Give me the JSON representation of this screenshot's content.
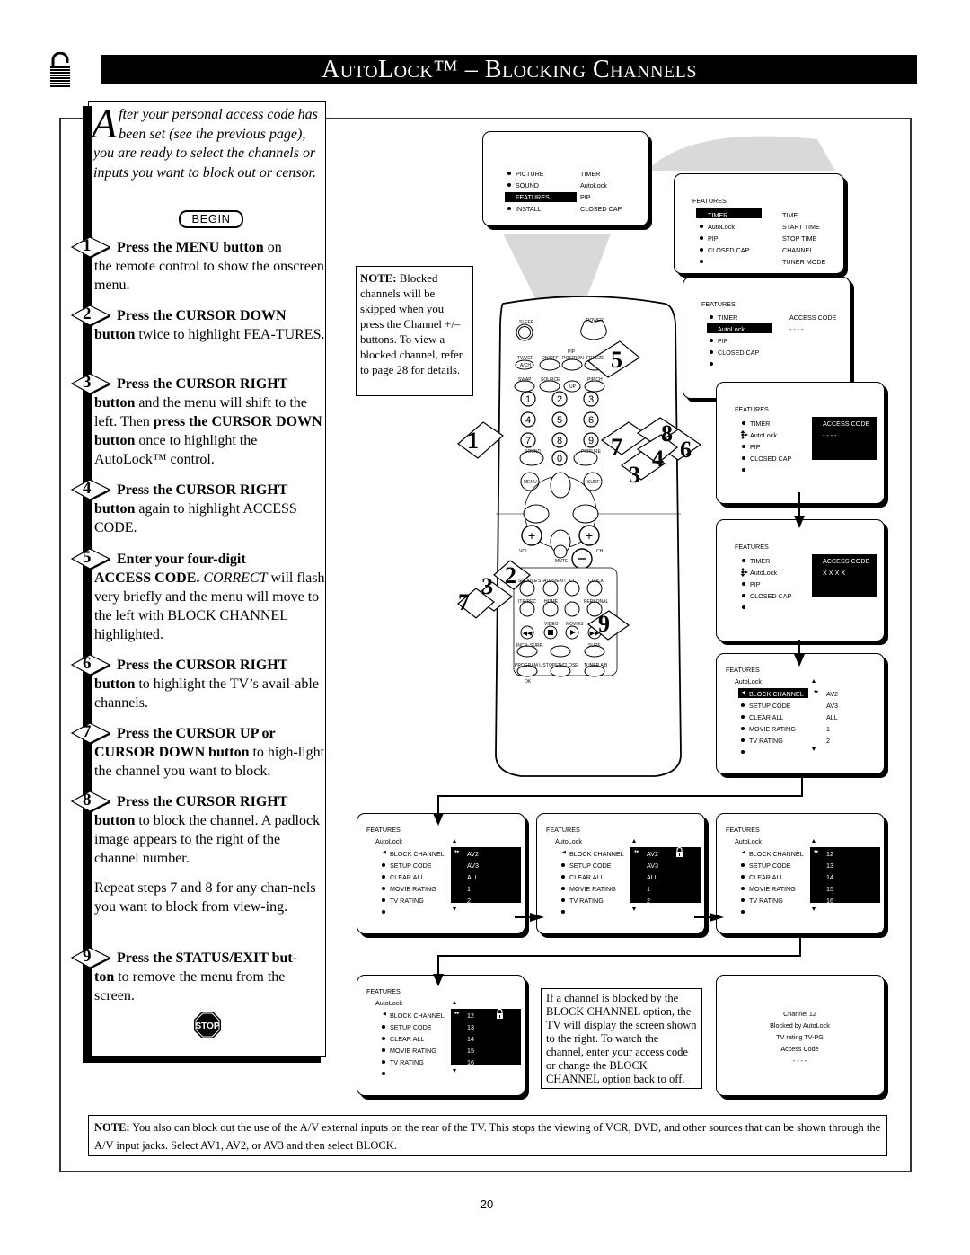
{
  "header": {
    "title": "AutoLock™ – Blocking Channels",
    "icon": "padlock-icon"
  },
  "intro": {
    "dropcap": "A",
    "text": "fter your personal access code has been set (see the previous page), you are ready to select the channels or inputs you want to block out or censor."
  },
  "begin_label": "BEGIN",
  "steps": [
    {
      "num": "1",
      "head": "Press the MENU button",
      "head_tail": " on",
      "body": "the remote control to show the onscreen menu."
    },
    {
      "num": "2",
      "head": "Press the CURSOR DOWN",
      "body_bold": "button",
      "body": " twice to highlight FEA-TURES."
    },
    {
      "num": "3",
      "head": "Press the CURSOR RIGHT",
      "body_bold": "button",
      "body": " and the menu will shift to the left. Then ",
      "body_bold2": "press the CURSOR DOWN button",
      "body2": " once to highlight the AutoLock™ control."
    },
    {
      "num": "4",
      "head": "Press the CURSOR RIGHT",
      "body_bold": "button",
      "body": " again to highlight ACCESS CODE."
    },
    {
      "num": "5",
      "head": "Enter your four-digit",
      "body_bold": "ACCESS CODE.",
      "body_italic": " CORRECT",
      "body": " will flash very briefly and the menu will move to the left with BLOCK CHANNEL highlighted."
    },
    {
      "num": "6",
      "head": "Press the CURSOR RIGHT",
      "body_bold": "button",
      "body": " to highlight the TV’s avail-able channels."
    },
    {
      "num": "7",
      "head": "Press the CURSOR UP or",
      "body_bold": "CURSOR DOWN button",
      "body": " to high-light the channel you want to block."
    },
    {
      "num": "8",
      "head": "Press the CURSOR RIGHT",
      "body_bold": "button",
      "body": " to block the channel.  A padlock image appears to the right of the channel number.",
      "extra": "Repeat steps 7 and 8 for any chan-nels you want to block from view-ing."
    },
    {
      "num": "9",
      "head": "Press the STATUS/EXIT but-",
      "body_bold": "ton",
      "body": " to remove the menu from the screen."
    }
  ],
  "stop_label": "STOP",
  "note_blocked": {
    "label": "NOTE:",
    "text": " Blocked channels will be skipped when you press the Channel +/– buttons.  To view a blocked channel, refer to page 28 for details."
  },
  "screens": {
    "main_menu": {
      "left": [
        "PICTURE",
        "SOUND",
        "FEATURES",
        "INSTALL"
      ],
      "right": [
        "TIMER",
        "AutoLock",
        "PIP",
        "CLOSED CAP"
      ],
      "highlighted": "FEATURES"
    },
    "features_timer": {
      "title": "FEATURES",
      "left": [
        "TIMER",
        "AutoLock",
        "PIP",
        "CLOSED CAP",
        ""
      ],
      "right": [
        "TIME",
        "START TIME",
        "STOP TIME",
        "CHANNEL",
        "TUNER MODE"
      ],
      "highlighted": "TIMER"
    },
    "features_autolock": {
      "title": "FEATURES",
      "left": [
        "TIMER",
        "AutoLock",
        "PIP",
        "CLOSED CAP",
        ""
      ],
      "access_label": "ACCESS CODE",
      "access_value": "- - - -",
      "highlighted": "AutoLock"
    },
    "features_access": {
      "title": "FEATURES",
      "left": [
        "TIMER",
        "AutoLock",
        "PIP",
        "CLOSED CAP",
        ""
      ],
      "access_label": "ACCESS CODE",
      "access_value": "- - - -"
    },
    "features_access_entered": {
      "title": "FEATURES",
      "left": [
        "TIMER",
        "AutoLock",
        "PIP",
        "CLOSED CAP",
        ""
      ],
      "access_label": "ACCESS CODE",
      "access_value": "X X X X"
    },
    "autolock_menu": {
      "title": "FEATURES",
      "subtitle": "AutoLock",
      "left": [
        "BLOCK CHANNEL",
        "SETUP CODE",
        "CLEAR ALL",
        "MOVIE RATING",
        "TV RATING",
        ""
      ],
      "right": [
        "AV2",
        "AV3",
        "ALL",
        "1",
        "2"
      ]
    },
    "autolock_av": {
      "title": "FEATURES",
      "subtitle": "AutoLock",
      "left": [
        "BLOCK CHANNEL",
        "SETUP CODE",
        "CLEAR ALL",
        "MOVIE RATING",
        "TV RATING",
        ""
      ],
      "right": [
        "AV2",
        "AV3",
        "ALL",
        "1",
        "2"
      ]
    },
    "autolock_av_locked": {
      "title": "FEATURES",
      "subtitle": "AutoLock",
      "left": [
        "BLOCK CHANNEL",
        "SETUP CODE",
        "CLEAR ALL",
        "MOVIE RATING",
        "TV RATING",
        ""
      ],
      "right": [
        "AV2",
        "AV3",
        "ALL",
        "1",
        "2"
      ],
      "locked": true
    },
    "autolock_ch": {
      "title": "FEATURES",
      "subtitle": "AutoLock",
      "left": [
        "BLOCK CHANNEL",
        "SETUP CODE",
        "CLEAR ALL",
        "MOVIE RATING",
        "TV RATING",
        ""
      ],
      "right": [
        "12",
        "13",
        "14",
        "15",
        "16"
      ]
    },
    "autolock_ch_locked": {
      "title": "FEATURES",
      "subtitle": "AutoLock",
      "left": [
        "BLOCK CHANNEL",
        "SETUP CODE",
        "CLEAR ALL",
        "MOVIE RATING",
        "TV RATING",
        ""
      ],
      "right": [
        "12",
        "13",
        "14",
        "15",
        "16"
      ],
      "locked": true
    },
    "blocked_screen": {
      "lines": [
        "Channel  12",
        "Blocked  by  AutoLock",
        "TV  rating  TV-PG",
        "Access  Code",
        "-  -  -  -"
      ]
    }
  },
  "note_block_channel": "If a channel is blocked by the BLOCK CHANNEL option, the TV will display the screen shown to the right. To watch the channel, enter your access code or change the BLOCK CHANNEL option back to off.",
  "note_av": {
    "label": "NOTE:",
    "text": "  You also can block out the use of the A/V external inputs on the rear of the TV.  This stops the viewing of VCR, DVD, and other sources that can be shown through the A/V input jacks. Select AV1, AV2, or AV3 and then select BLOCK."
  },
  "remote": {
    "labels": {
      "sleep": "SLEEP",
      "power": "POWER",
      "pip": "PIP",
      "tvvcr": "TV/VCR",
      "onoff": "ON/OFF",
      "position": "POSITION",
      "freeze": "FREEZE",
      "ach": "A/CH",
      "swap": "SWAP",
      "source": "SOURCE",
      "pipch": "PIP CH",
      "up": "UP",
      "sound": "SOUND",
      "picture": "PICTURE",
      "menu": "MENU",
      "surf": "SURF",
      "vol": "VOL",
      "ch": "CH",
      "mute": "MUTE",
      "source2": "SOURCE",
      "statusexit": "STATUS/EXIT",
      "cc": "CC",
      "clock": "CLOCK",
      "itrrec": "ITR/REC",
      "home": "HOME",
      "personal": "PERSONAL",
      "video": "VIDEO",
      "movies": "MOVIES",
      "incrsurr": "INCR. SURR.",
      "surf2": "SURF",
      "programlist": "PROGRAM LIST",
      "openclose": "OPEN/CLOSE",
      "tunerab": "TUNER A/B",
      "ok": "OK"
    },
    "digits": [
      "1",
      "2",
      "3",
      "4",
      "5",
      "6",
      "7",
      "8",
      "9",
      "0"
    ],
    "callouts": [
      "1",
      "2",
      "3",
      "4",
      "5",
      "6",
      "7",
      "8",
      "9",
      "3",
      "7"
    ]
  },
  "page_number": "20"
}
